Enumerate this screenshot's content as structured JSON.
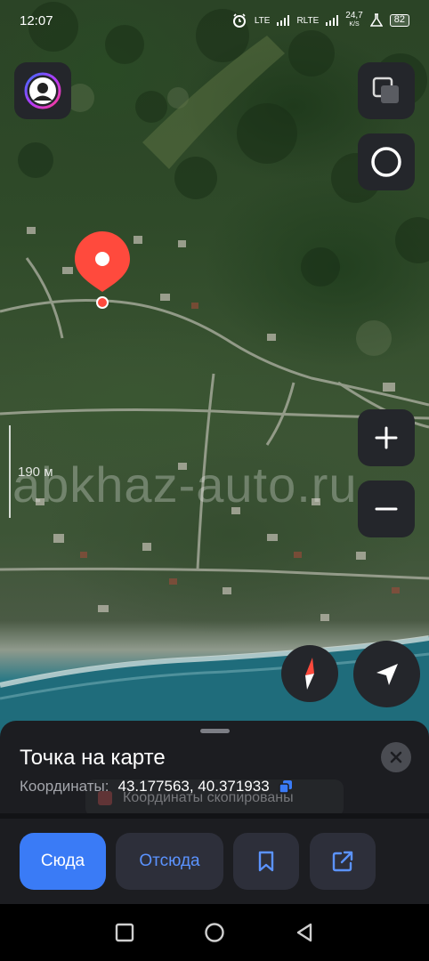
{
  "status_bar": {
    "time": "12:07",
    "network_1": "LTE",
    "network_2": "RLTE",
    "speed_value": "24,7",
    "speed_unit": "K/S",
    "battery": "82"
  },
  "map": {
    "scale_label": "190 м",
    "watermark": "abkhaz-auto.ru",
    "marker_color": "#ff4a3d"
  },
  "sheet": {
    "title": "Точка на карте",
    "coords_label": "Координаты:",
    "coords_value": "43.177563, 40.371933",
    "toast_text": "Координаты скопированы",
    "buttons": {
      "here": "Сюда",
      "from_here": "Отсюда"
    }
  },
  "colors": {
    "accent": "#3a7bf6",
    "accent_text": "#5b93ff",
    "sheet_bg": "#1c1d21",
    "control_bg": "#24262b"
  },
  "icons": [
    "profile-icon",
    "layers-icon",
    "circle-icon",
    "zoom-in-icon",
    "zoom-out-icon",
    "compass-icon",
    "navigation-arrow-icon",
    "close-icon",
    "copy-icon",
    "bookmark-icon",
    "share-icon",
    "nav-recent-icon",
    "nav-home-icon",
    "nav-back-icon"
  ]
}
